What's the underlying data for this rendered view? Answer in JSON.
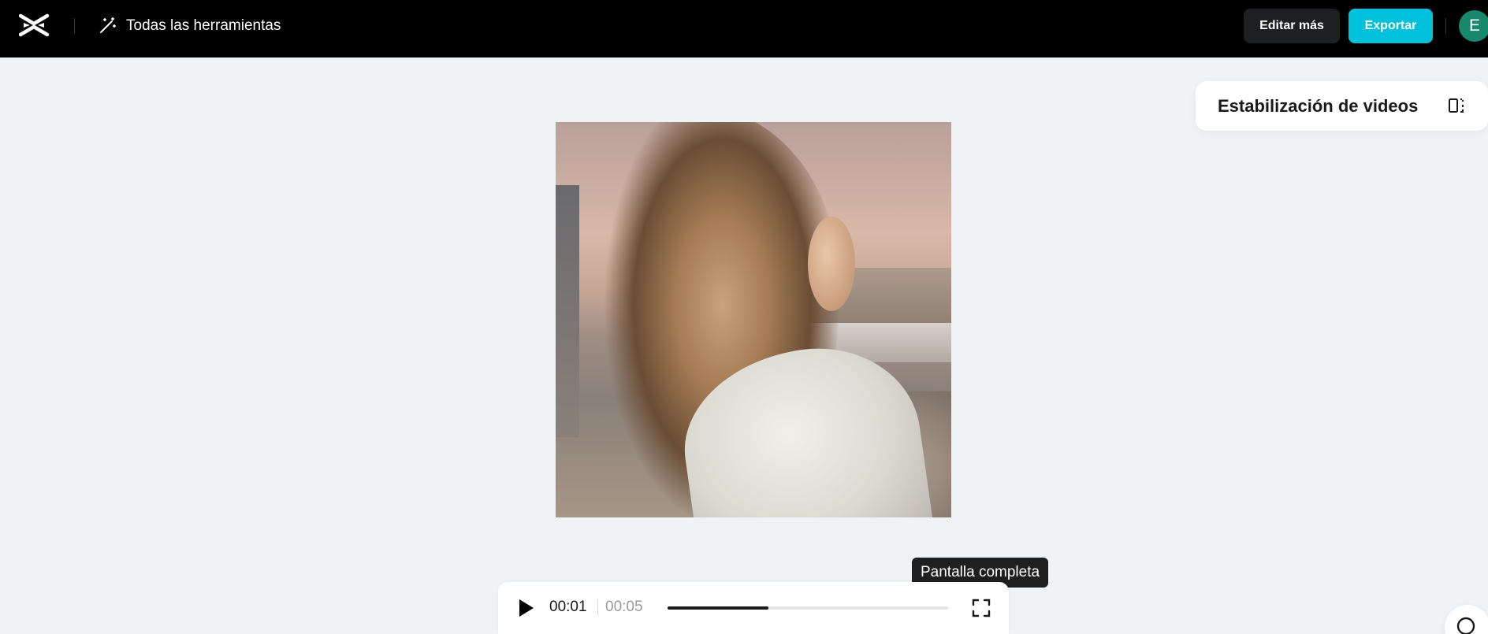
{
  "header": {
    "logo_icon": "capcut-logo-icon",
    "tools_icon": "magic-wand-icon",
    "all_tools_label": "Todas las herramientas",
    "edit_more_label": "Editar más",
    "export_label": "Exportar",
    "avatar_initial": "E",
    "colors": {
      "bar": "#000000",
      "export": "#00c1dc",
      "avatar": "#17886c"
    }
  },
  "panel": {
    "feature_title": "Estabilización de videos",
    "toggle_icon": "panel-toggle-icon"
  },
  "player": {
    "tooltip": "Pantalla completa",
    "current_time": "00:01",
    "total_time": "00:05",
    "progress_fraction": 0.36,
    "play_icon": "play-icon",
    "fullscreen_icon": "fullscreen-icon"
  },
  "help": {
    "icon": "chat-bubble-icon"
  }
}
